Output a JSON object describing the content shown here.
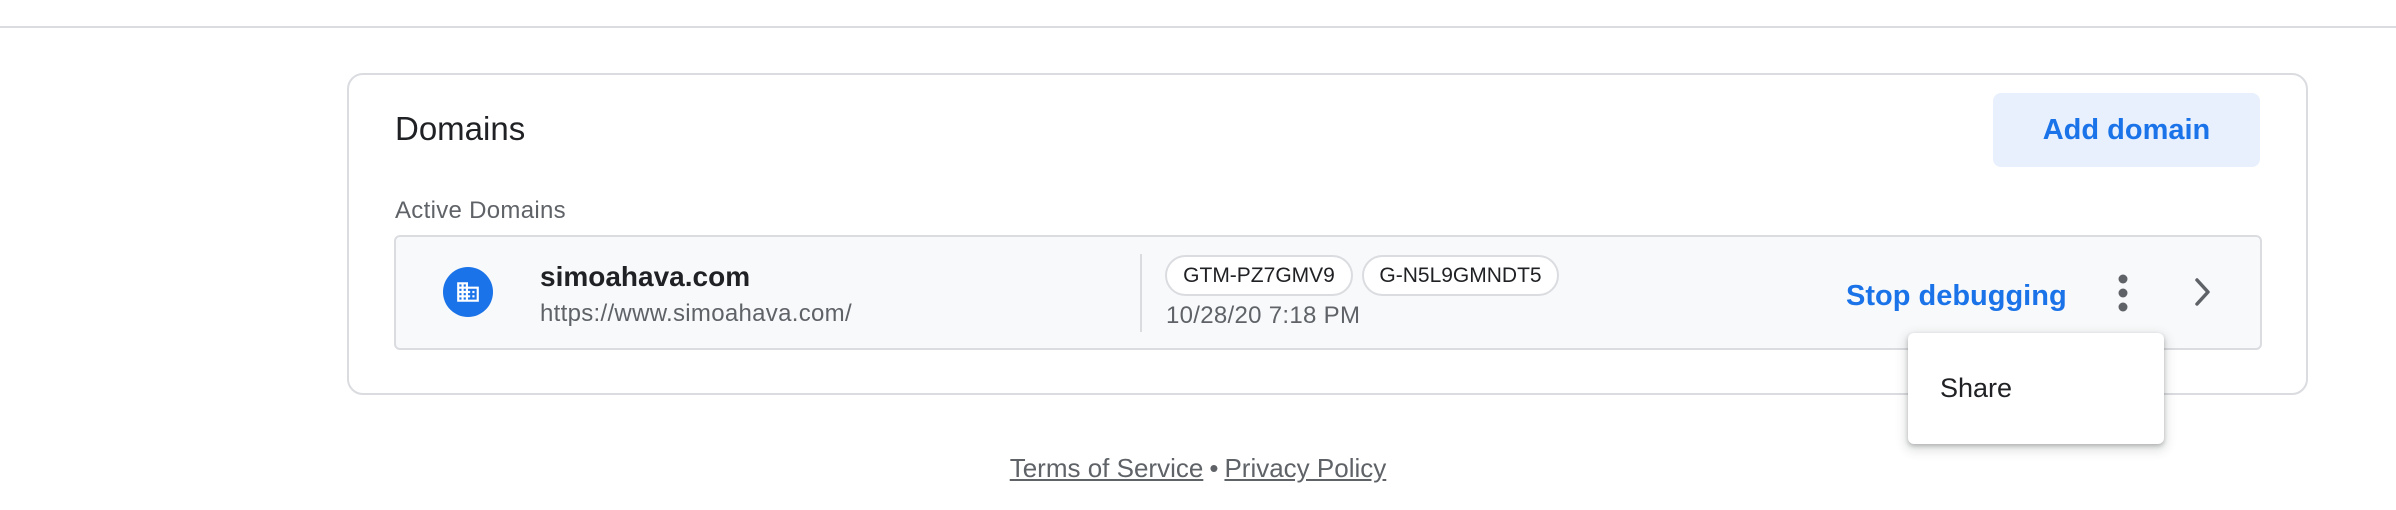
{
  "domains_card": {
    "title": "Domains",
    "add_domain_label": "Add domain",
    "section_label": "Active Domains"
  },
  "domains": [
    {
      "icon": "domain-icon",
      "name": "simoahava.com",
      "url": "https://www.simoahava.com/",
      "tags": [
        "GTM-PZ7GMV9",
        "G-N5L9GMNDT5"
      ],
      "timestamp": "10/28/20 7:18 PM",
      "action_label": "Stop debugging"
    }
  ],
  "context_menu": {
    "items": [
      "Share"
    ]
  },
  "footer": {
    "terms_label": "Terms of Service",
    "separator": "•",
    "privacy_label": "Privacy Policy"
  },
  "colors": {
    "accent": "#1a73e8",
    "accent_bg": "#e8f0fe",
    "border": "#dadce0",
    "row_bg": "#f8f9fa",
    "text_primary": "#202124",
    "text_secondary": "#5f6368"
  }
}
